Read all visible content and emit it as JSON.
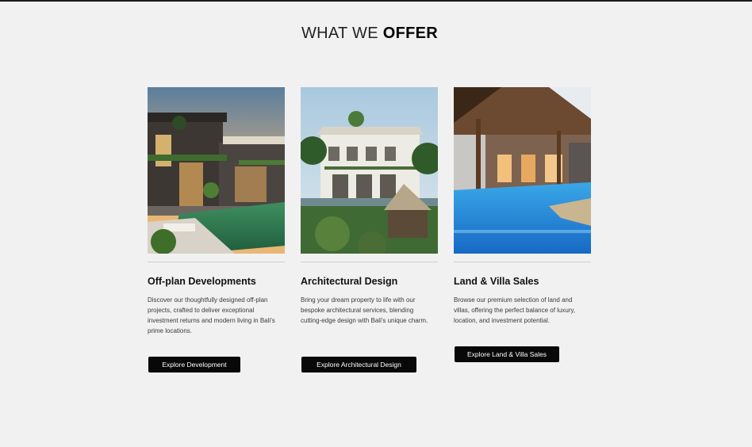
{
  "section": {
    "title_light": "WHAT WE ",
    "title_bold": "OFFER"
  },
  "cards": [
    {
      "title": "Off-plan Developments",
      "description": "Discover our thoughtfully designed off-plan projects, crafted to deliver exceptional investment returns and modern living in Bali's prime locations.",
      "button_label": "Explore Development",
      "image": "modern-villa-pool-dusk"
    },
    {
      "title": "Architectural Design",
      "description": "Bring your dream property to life with our bespoke architectural services, blending cutting-edge design with Bali's unique charm.",
      "button_label": "Explore Architectural Design",
      "image": "white-villa-tropical-garden"
    },
    {
      "title": "Land & Villa Sales",
      "description": "Browse our premium selection of land and villas, offering the perfect balance of luxury, location, and investment potential.",
      "button_label": "Explore Land & Villa Sales",
      "image": "villa-courtyard-blue-pool"
    }
  ],
  "colors": {
    "background": "#f1f1f1",
    "button": "#080808",
    "divider": "#cfcfcf"
  }
}
